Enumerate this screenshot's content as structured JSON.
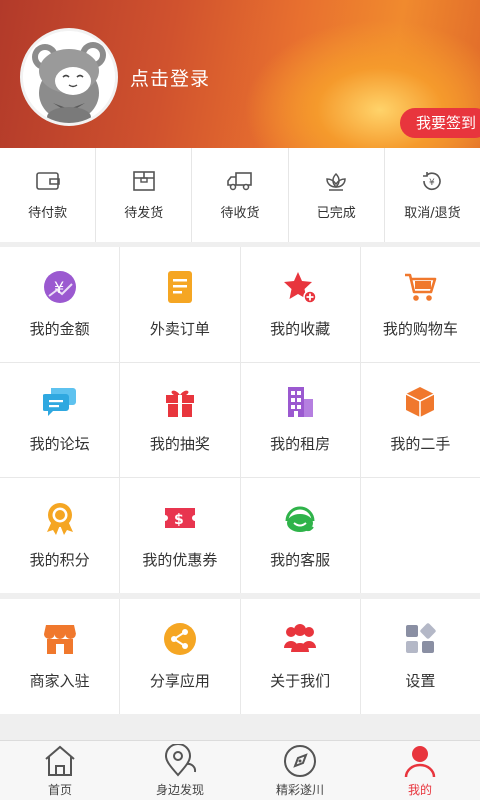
{
  "header": {
    "login_text": "点击登录",
    "signin_button": "我要签到",
    "avatar_icon": "bear-mascot-avatar"
  },
  "orders": [
    {
      "label": "待付款",
      "icon": "wallet-icon"
    },
    {
      "label": "待发货",
      "icon": "package-icon"
    },
    {
      "label": "待收货",
      "icon": "truck-icon"
    },
    {
      "label": "已完成",
      "icon": "lotus-check-icon"
    },
    {
      "label": "取消/退货",
      "icon": "refund-icon"
    }
  ],
  "features": [
    {
      "label": "我的金额",
      "icon": "money-icon",
      "color": "#9b59d0"
    },
    {
      "label": "外卖订单",
      "icon": "order-icon",
      "color": "#f5a623"
    },
    {
      "label": "我的收藏",
      "icon": "star-icon",
      "color": "#e8353d"
    },
    {
      "label": "我的购物车",
      "icon": "cart-icon",
      "color": "#f0782d"
    },
    {
      "label": "我的论坛",
      "icon": "chat-icon",
      "color": "#2fa8e0"
    },
    {
      "label": "我的抽奖",
      "icon": "gift-icon",
      "color": "#e8353d"
    },
    {
      "label": "我的租房",
      "icon": "building-icon",
      "color": "#9b59d0"
    },
    {
      "label": "我的二手",
      "icon": "box-icon",
      "color": "#f0782d"
    },
    {
      "label": "我的积分",
      "icon": "medal-icon",
      "color": "#f5a623"
    },
    {
      "label": "我的优惠券",
      "icon": "coupon-icon",
      "color": "#e8354f"
    },
    {
      "label": "我的客服",
      "icon": "headset-icon",
      "color": "#2fb34a"
    }
  ],
  "tools": [
    {
      "label": "商家入驻",
      "icon": "shop-icon",
      "color": "#f0782d"
    },
    {
      "label": "分享应用",
      "icon": "share-icon",
      "color": "#f5a623"
    },
    {
      "label": "关于我们",
      "icon": "group-icon",
      "color": "#e8353d"
    },
    {
      "label": "设置",
      "icon": "settings-grid-icon",
      "color": "#8a8fa3"
    }
  ],
  "nav": [
    {
      "label": "首页",
      "icon": "home-icon"
    },
    {
      "label": "身边发现",
      "icon": "location-icon"
    },
    {
      "label": "精彩遂川",
      "icon": "compass-icon"
    },
    {
      "label": "我的",
      "icon": "person-icon",
      "active": true
    }
  ]
}
